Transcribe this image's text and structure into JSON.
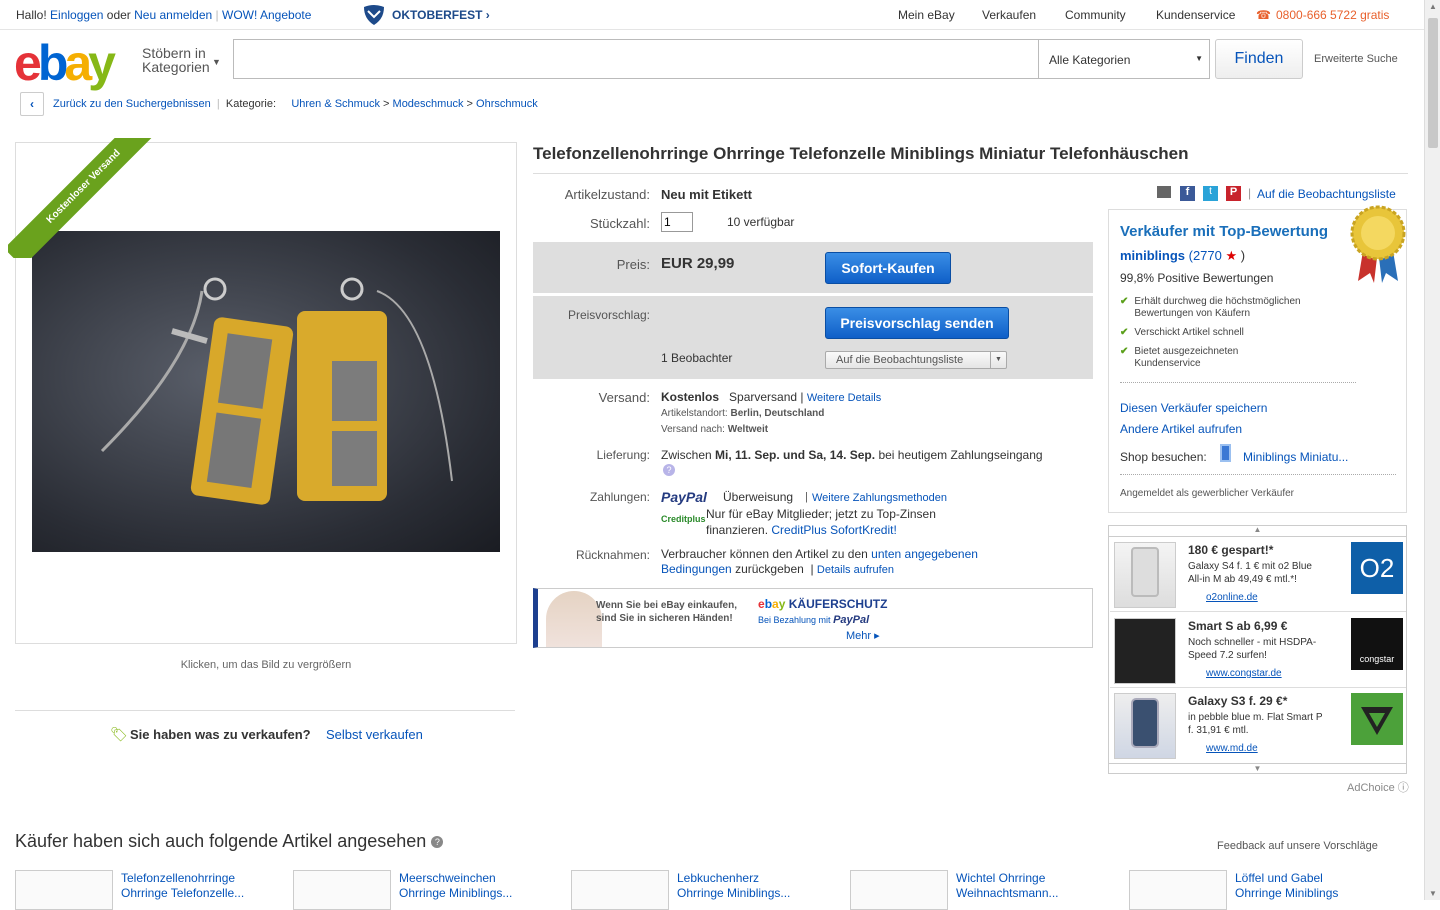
{
  "topbar": {
    "hallo": "Hallo!",
    "login": "Einloggen",
    "oder": "oder",
    "register": "Neu anmelden",
    "wow": "WOW! Angebote",
    "oktoberfest": "OKTOBERFEST",
    "nav": [
      "Mein eBay",
      "Verkaufen",
      "Community",
      "Kundenservice"
    ],
    "phone": "0800-666 5722 gratis"
  },
  "header": {
    "logo": [
      "e",
      "b",
      "a",
      "y"
    ],
    "browse": "Stöbern in",
    "browse2": "Kategorien",
    "search_placeholder": "",
    "category": "Alle Kategorien",
    "find": "Finden",
    "advanced": "Erweiterte Suche"
  },
  "breadcrumb": {
    "back": "Zurück zu den Suchergebnissen",
    "category_label": "Kategorie:",
    "path": [
      "Uhren & Schmuck",
      "Modeschmuck",
      "Ohrschmuck"
    ],
    "sep": ">"
  },
  "image": {
    "banner": "Kostenloser Versand",
    "caption": "Klicken, um das Bild zu vergrößern"
  },
  "sell": {
    "question": "Sie haben was zu verkaufen?",
    "link": "Selbst verkaufen"
  },
  "item": {
    "title": "Telefonzellenohrringe Ohrringe Telefonzelle Miniblings Miniatur Telefonhäuschen",
    "condition_label": "Artikelzustand:",
    "condition": "Neu mit Etikett",
    "qty_label": "Stückzahl:",
    "qty": "1",
    "available": "10 verfügbar",
    "price_label": "Preis:",
    "price": "EUR 29,99",
    "buy": "Sofort-Kaufen",
    "offer_label": "Preisvorschlag:",
    "offer": "Preisvorschlag senden",
    "watchers": "1 Beobachter",
    "watch": "Auf die Beobachtungsliste",
    "shipping_label": "Versand:",
    "shipping": "Kostenlos",
    "shipping_type": "Sparversand",
    "shipping_more": "Weitere Details",
    "location_label": "Artikelstandort:",
    "location": "Berlin, Deutschland",
    "ship_to_label": "Versand nach:",
    "ship_to": "Weltweit",
    "delivery_label": "Lieferung:",
    "delivery_pre": "Zwischen",
    "delivery_dates": "Mi, 11. Sep. und Sa, 14. Sep.",
    "delivery_post": "bei heutigem Zahlungseingang",
    "payment_label": "Zahlungen:",
    "paypal": "PayPal",
    "transfer": "Überweisung",
    "more_payment": "Weitere Zahlungsmethoden",
    "creditplus": "Creditplus",
    "credit_text": "Nur für eBay Mitglieder; jetzt zu Top-Zinsen",
    "credit_text2": "finanzieren.",
    "credit_link": "CreditPlus SofortKredit!",
    "returns_label": "Rücknahmen:",
    "returns_pre": "Verbraucher können den Artikel zu den",
    "returns_link": "unten angegebenen",
    "returns_link2": "Bedingungen",
    "returns_post": "zurückgeben",
    "returns_details": "Details aufrufen",
    "protection1": "Wenn Sie bei eBay einkaufen,",
    "protection2": "sind Sie in sicheren Händen!",
    "protection_title": "KÄUFERSCHUTZ",
    "protection_sub": "Bei Bezahlung mit",
    "protection_more": "Mehr ▸"
  },
  "seller": {
    "watchlist": "Auf die Beobachtungsliste",
    "top": "Verkäufer mit Top-Bewertung",
    "name": "miniblings",
    "score": "(2770",
    "close": ")",
    "positive": "99,8% Positive Bewertungen",
    "points": [
      "Erhält durchweg die höchstmöglichen Bewertungen von Käufern",
      "Verschickt Artikel schnell",
      "Bietet ausgezeichneten Kundenservice"
    ],
    "save": "Diesen Verkäufer speichern",
    "other": "Andere Artikel aufrufen",
    "shop_label": "Shop besuchen:",
    "shop": "Miniblings Miniatu...",
    "business": "Angemeldet als gewerblicher Verkäufer"
  },
  "ads": [
    {
      "title": "180 € gespart!*",
      "text": "Galaxy S4 f. 1 € mit o2 Blue All-in M ab 49,49 € mtl.*!",
      "link": "o2online.de",
      "brand": "O2"
    },
    {
      "title": "Smart S ab 6,99 €",
      "text": "Noch schneller - mit HSDPA-Speed 7.2 surfen!",
      "link": "www.congstar.de",
      "brand": "congstar"
    },
    {
      "title": "Galaxy S3 f. 29 €*",
      "text": "in pebble blue m. Flat Smart P f. 31,91 € mtl.",
      "link": "www.md.de",
      "brand": ""
    }
  ],
  "adchoice": "AdChoice",
  "recs": {
    "title": "Käufer haben sich auch folgende Artikel angesehen",
    "feedback": "Feedback auf unsere Vorschläge",
    "items": [
      [
        "Telefonzellenohrringe",
        "Ohrringe Telefonzelle..."
      ],
      [
        "Meerschweinchen",
        "Ohrringe Miniblings..."
      ],
      [
        "Lebkuchenherz",
        "Ohrringe Miniblings..."
      ],
      [
        "Wichtel Ohrringe",
        "Weihnachtsmann..."
      ],
      [
        "Löffel und Gabel",
        "Ohrringe Miniblings"
      ]
    ]
  },
  "colors": {
    "link": "#0654ba",
    "buy": "#1a6fd6",
    "topseller": "#1a6fba"
  }
}
